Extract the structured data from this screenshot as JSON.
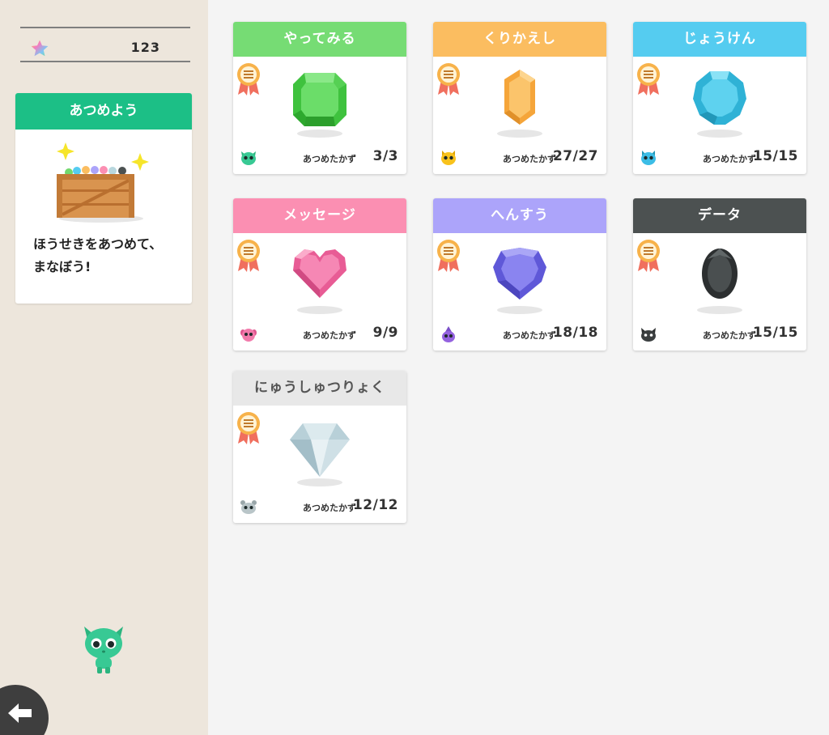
{
  "sidebar": {
    "score": "123",
    "collect_card": {
      "title": "あつめよう",
      "text_line1": "ほうせきをあつめて、",
      "text_line2": "まなぼう!"
    }
  },
  "colors": {
    "sidebar_bg": "#ede6dc",
    "collect_header": "#1cbf86"
  },
  "cards": [
    {
      "title": "やってみる",
      "header_color": "#76dc74",
      "header_text_color": "#ffffff",
      "gem_icon": "green-emerald-gem",
      "creature_icon": "green-creature",
      "count_label": "あつめたかず",
      "count": "3/3"
    },
    {
      "title": "くりかえし",
      "header_color": "#fbbd60",
      "header_text_color": "#ffffff",
      "gem_icon": "orange-hexagon-gem",
      "creature_icon": "yellow-creature",
      "count_label": "あつめたかず",
      "count": "27/27"
    },
    {
      "title": "じょうけん",
      "header_color": "#55ccf0",
      "header_text_color": "#ffffff",
      "gem_icon": "blue-round-gem",
      "creature_icon": "blue-creature",
      "count_label": "あつめたかず",
      "count": "15/15"
    },
    {
      "title": "メッセージ",
      "header_color": "#fb8fb2",
      "header_text_color": "#ffffff",
      "gem_icon": "pink-heart-gem",
      "creature_icon": "pink-creature",
      "count_label": "あつめたかず",
      "count": "9/9"
    },
    {
      "title": "へんすう",
      "header_color": "#aca4fa",
      "header_text_color": "#ffffff",
      "gem_icon": "purple-shield-gem",
      "creature_icon": "purple-creature",
      "count_label": "あつめたかず",
      "count": "18/18"
    },
    {
      "title": "データ",
      "header_color": "#4c5151",
      "header_text_color": "#ffffff",
      "gem_icon": "black-oval-gem",
      "creature_icon": "black-cat-creature",
      "count_label": "あつめたかず",
      "count": "15/15"
    },
    {
      "title": "にゅうしゅつりょく",
      "header_color": "#e8e8e8",
      "header_text_color": "#555555",
      "gem_icon": "white-diamond-gem",
      "creature_icon": "gray-creature",
      "count_label": "あつめたかず",
      "count": "12/12"
    }
  ]
}
